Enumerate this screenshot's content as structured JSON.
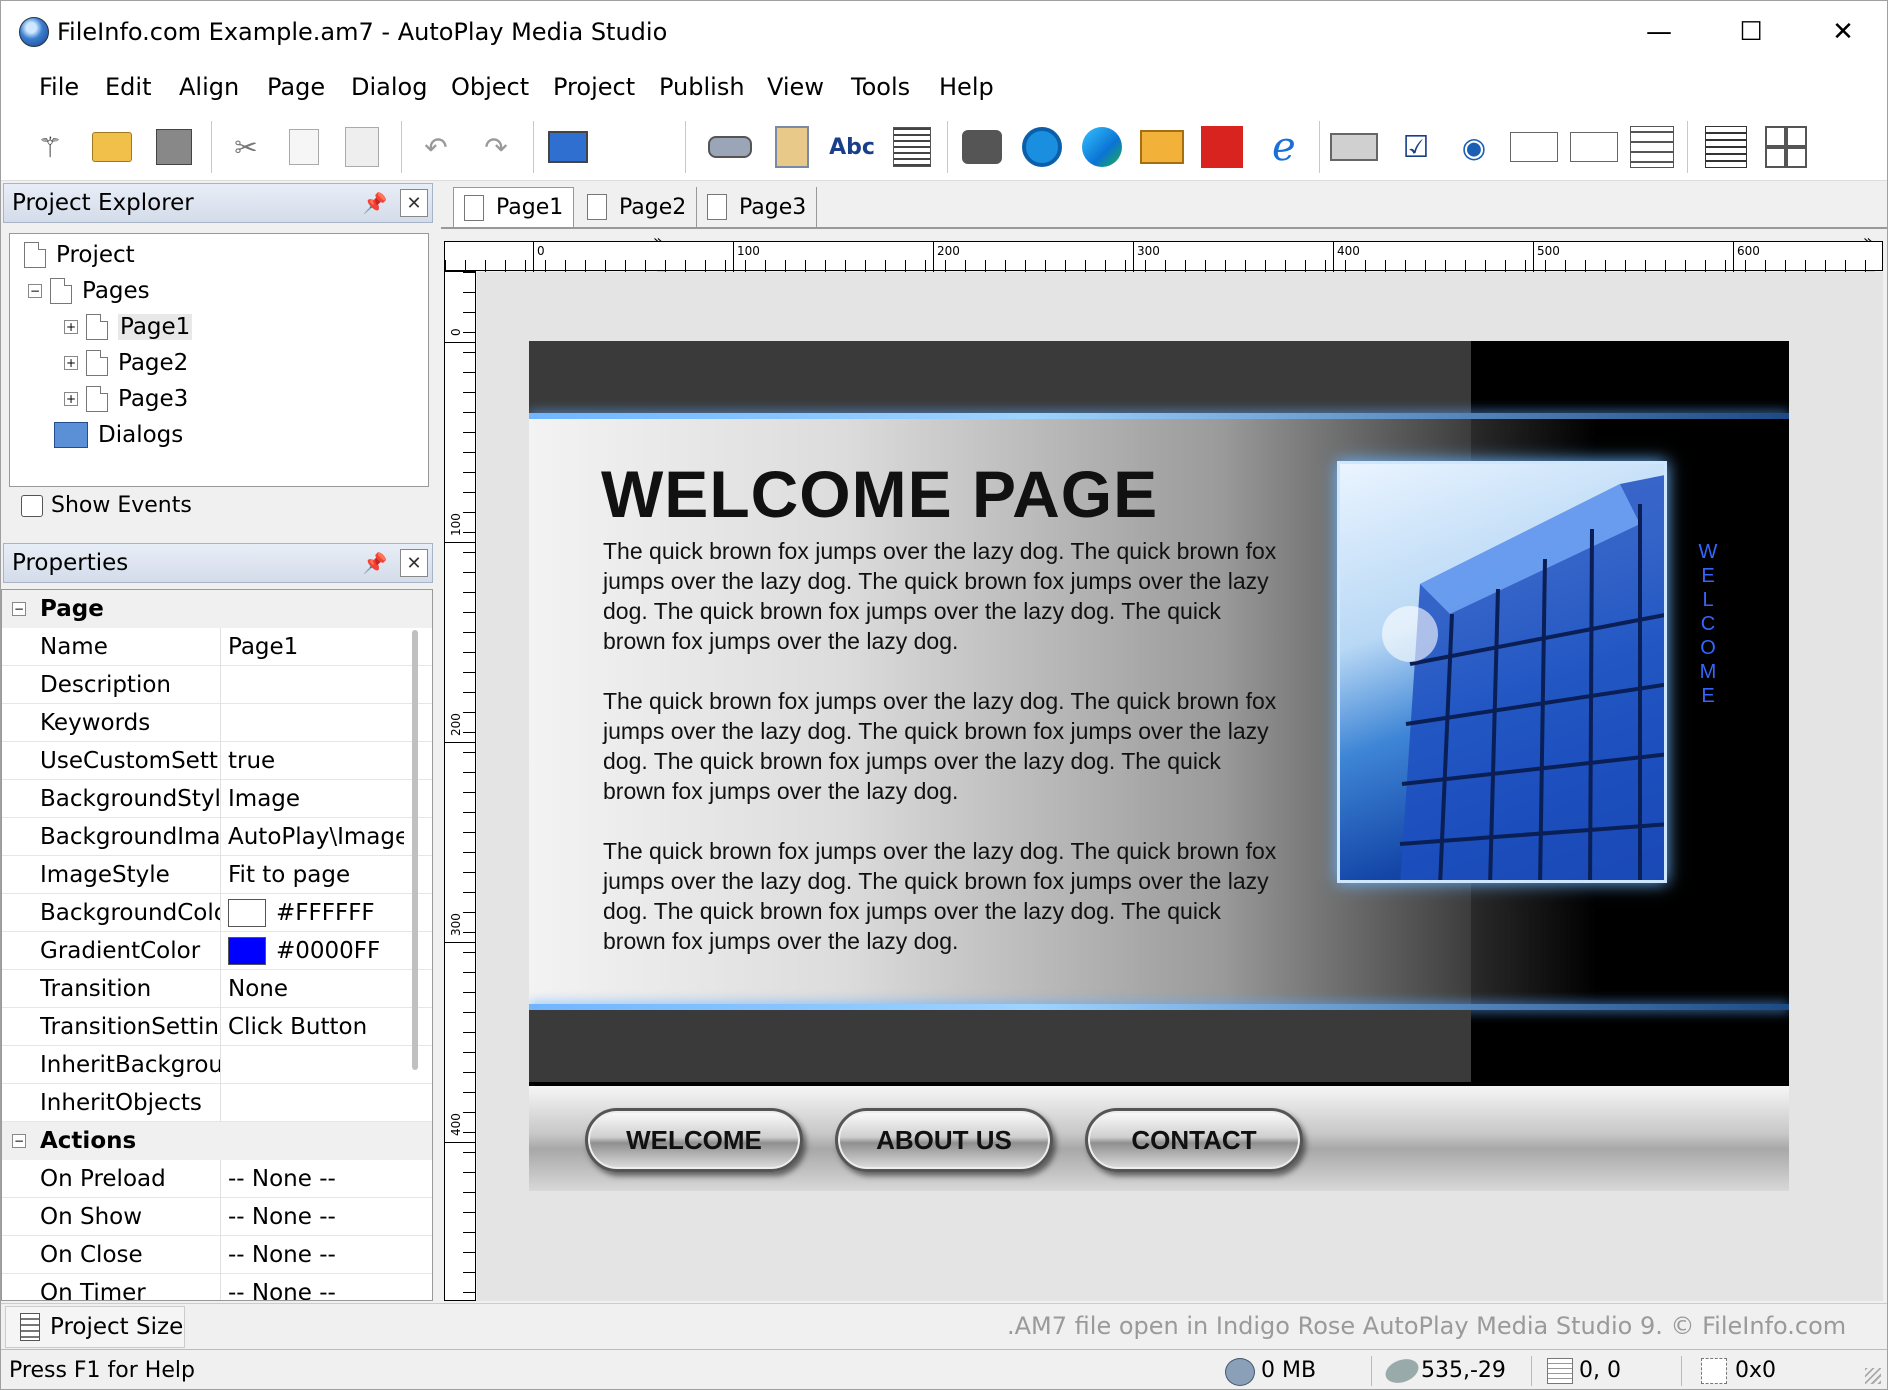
{
  "window": {
    "title": "FileInfo.com Example.am7 - AutoPlay Media Studio",
    "minimize": "—",
    "maximize": "☐",
    "close": "✕"
  },
  "menu": [
    "File",
    "Edit",
    "Align",
    "Page",
    "Dialog",
    "Object",
    "Project",
    "Publish",
    "View",
    "Tools",
    "Help"
  ],
  "toolbar": {
    "overflow": "»",
    "dropdown": "▾",
    "text_tool_label": "Abc"
  },
  "project_explorer": {
    "title": "Project Explorer",
    "tree": {
      "root": "Project",
      "pages": "Pages",
      "page_items": [
        "Page1",
        "Page2",
        "Page3"
      ],
      "dialogs": "Dialogs"
    },
    "show_events": "Show Events"
  },
  "properties": {
    "title": "Properties",
    "group_page": "Page",
    "rows": [
      {
        "key": "Name",
        "value": "Page1"
      },
      {
        "key": "Description",
        "value": ""
      },
      {
        "key": "Keywords",
        "value": ""
      },
      {
        "key": "UseCustomSettings",
        "value": "true"
      },
      {
        "key": "BackgroundStyle",
        "value": "Image"
      },
      {
        "key": "BackgroundImage",
        "value": "AutoPlay\\Images"
      },
      {
        "key": "ImageStyle",
        "value": "Fit to page"
      },
      {
        "key": "BackgroundColor",
        "value": "#FFFFFF"
      },
      {
        "key": "GradientColor",
        "value": "#0000FF"
      },
      {
        "key": "Transition",
        "value": "None"
      },
      {
        "key": "TransitionSettings",
        "value": "Click Button"
      },
      {
        "key": "InheritBackground",
        "value": ""
      },
      {
        "key": "InheritObjects",
        "value": ""
      }
    ],
    "group_actions": "Actions",
    "actions": [
      {
        "key": "On Preload",
        "value": "-- None --"
      },
      {
        "key": "On Show",
        "value": "-- None --"
      },
      {
        "key": "On Close",
        "value": "-- None --"
      },
      {
        "key": "On Timer",
        "value": "-- None --"
      }
    ],
    "colors": {
      "background": "#FFFFFF",
      "gradient": "#0000FF"
    }
  },
  "tabs": [
    "Page1",
    "Page2",
    "Page3"
  ],
  "ruler": {
    "h_labels": [
      "0",
      "100",
      "200",
      "300",
      "400",
      "500",
      "600"
    ],
    "v_labels": [
      "0",
      "100",
      "200",
      "300",
      "400"
    ]
  },
  "stage": {
    "title": "WELCOME PAGE",
    "paragraphs": [
      "The quick brown fox jumps over the lazy dog. The quick brown fox jumps over the lazy dog. The quick brown fox jumps over the lazy dog. The quick brown fox jumps over the lazy dog. The quick brown fox jumps over the lazy dog.",
      "The quick brown fox jumps over the lazy dog. The quick brown fox jumps over the lazy dog. The quick brown fox jumps over the lazy dog. The quick brown fox jumps over the lazy dog. The quick brown fox jumps over the lazy dog.",
      "The quick brown fox jumps over the lazy dog. The quick brown fox jumps over the lazy dog. The quick brown fox jumps over the lazy dog. The quick brown fox jumps over the lazy dog. The quick brown fox jumps over the lazy dog."
    ],
    "vertical_text": "WELCOME",
    "nav": [
      "WELCOME",
      "ABOUT US",
      "CONTACT"
    ]
  },
  "project_size": "Project Size",
  "watermark": ".AM7 file open in Indigo Rose AutoPlay Media Studio 9. © FileInfo.com",
  "status": {
    "help": "Press F1 for Help",
    "memory": "0 MB",
    "coords": "535,-29",
    "position": "0, 0",
    "size": "0x0"
  }
}
